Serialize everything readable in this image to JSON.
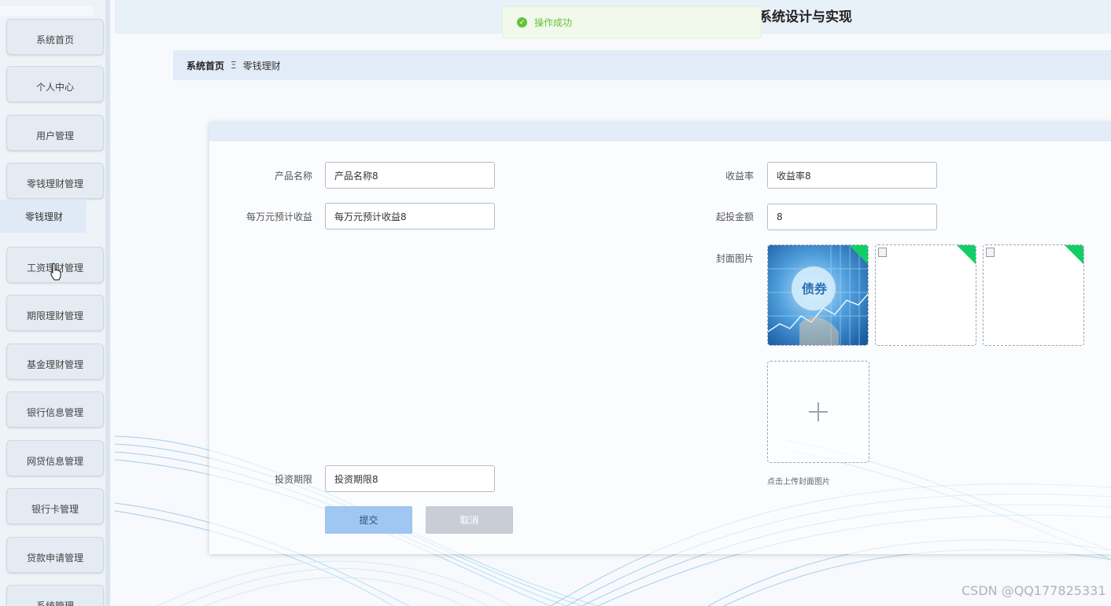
{
  "colors": {
    "accent": "#a0c7f2",
    "success": "#67c23a",
    "corner_badge": "#13ce66",
    "breadcrumb_bg": "#e1ecf8"
  },
  "header": {
    "system_title": "系统设计与实现"
  },
  "toast": {
    "icon": "check-circle-icon",
    "message": "操作成功"
  },
  "sidebar": {
    "items": [
      {
        "label": "系统首页"
      },
      {
        "label": "个人中心"
      },
      {
        "label": "用户管理"
      },
      {
        "label": "零钱理财管理"
      },
      {
        "label": "工资理财管理"
      },
      {
        "label": "期限理财管理"
      },
      {
        "label": "基金理财管理"
      },
      {
        "label": "银行信息管理"
      },
      {
        "label": "网贷信息管理"
      },
      {
        "label": "银行卡管理"
      },
      {
        "label": "贷款申请管理"
      },
      {
        "label": "系统管理"
      }
    ],
    "sub_item": "零钱理财"
  },
  "breadcrumb": {
    "home": "系统首页",
    "separator": "Ξ",
    "current": "零钱理财"
  },
  "form": {
    "product_name": {
      "label": "产品名称",
      "value": "产品名称8"
    },
    "yield_rate": {
      "label": "收益率",
      "value": "收益率8"
    },
    "per_10k_income": {
      "label": "每万元预计收益",
      "value": "每万元预计收益8"
    },
    "min_invest": {
      "label": "起投金额",
      "value": "8"
    },
    "cover": {
      "label": "封面图片",
      "image_text": "债券",
      "upload_icon": "plus-icon",
      "upload_tip": "点击上传封面图片"
    },
    "term": {
      "label": "投资期限",
      "value": "投资期限8"
    },
    "submit_label": "提交",
    "cancel_label": "取消"
  },
  "watermark": "CSDN @QQ177825331"
}
